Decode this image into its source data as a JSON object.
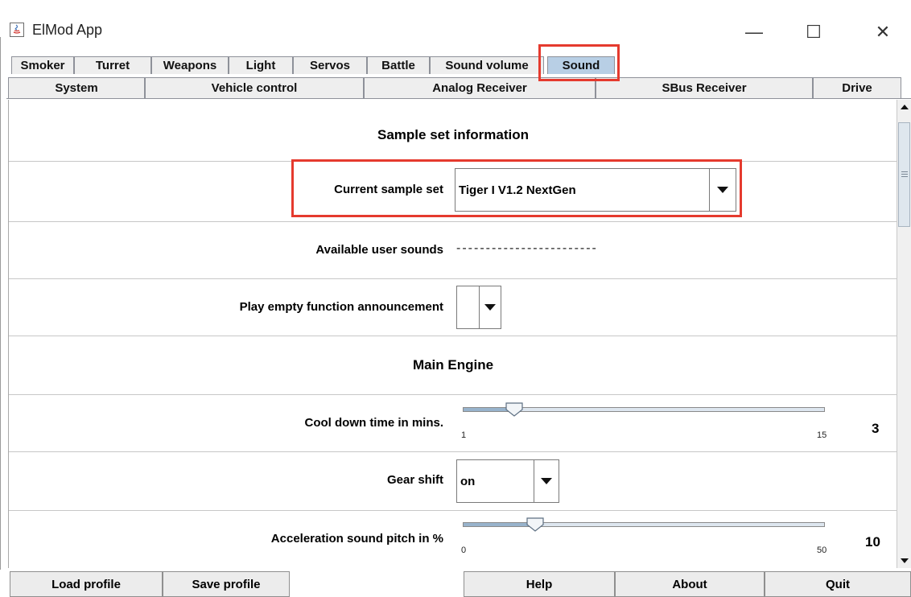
{
  "window": {
    "title": "ElMod App",
    "min_glyph": "—",
    "max_glyph": "☐",
    "close_glyph": "✕"
  },
  "tabs": {
    "row1": [
      "Smoker",
      "Turret",
      "Weapons",
      "Light",
      "Servos",
      "Battle",
      "Sound volume",
      "Sound"
    ],
    "row2": [
      "System",
      "Vehicle control",
      "Analog Receiver",
      "SBus Receiver",
      "Drive"
    ],
    "selected": "Sound"
  },
  "sound": {
    "sample_set_title": "Sample set information",
    "current_sample_set_label": "Current sample set",
    "current_sample_set_value": "Tiger I V1.2 NextGen",
    "available_user_sounds_label": "Available user sounds",
    "available_user_sounds_value": "------------------------",
    "play_empty_label": "Play empty function announcement",
    "play_empty_value": "",
    "main_engine_title": "Main Engine",
    "cool_down": {
      "label": "Cool down time in mins.",
      "min": "1",
      "max": "15",
      "value": "3",
      "fraction": 0.143
    },
    "gear_shift": {
      "label": "Gear shift",
      "value": "on"
    },
    "accel_pitch": {
      "label": "Acceleration sound pitch in %",
      "min": "0",
      "max": "50",
      "value": "10",
      "fraction": 0.2
    }
  },
  "bottom_buttons": [
    "Load profile",
    "Save profile",
    "Help",
    "About",
    "Quit"
  ],
  "colors": {
    "highlight": "#e53a2e",
    "selected_tab": "#b8cfe5"
  }
}
